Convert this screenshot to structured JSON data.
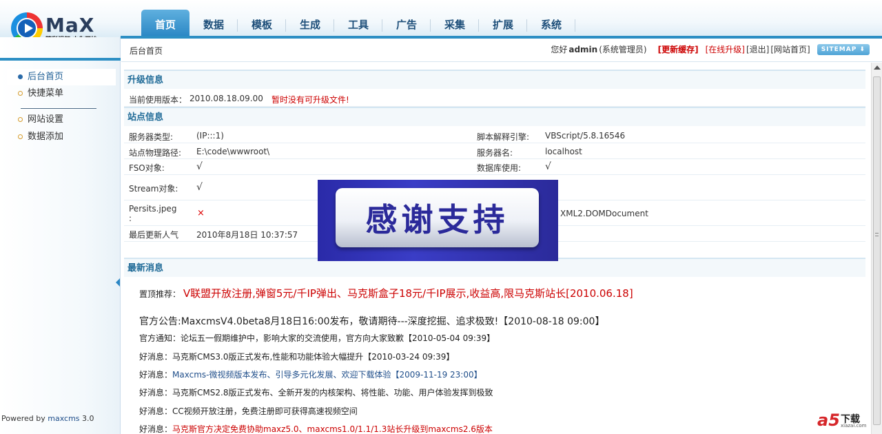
{
  "header": {
    "logo_word": "MaX",
    "logo_slogan": "精彩视频 由你开始",
    "nav": [
      "首页",
      "数据",
      "模板",
      "生成",
      "工具",
      "广告",
      "采集",
      "扩展",
      "系统"
    ]
  },
  "sidebar": {
    "items": [
      {
        "label": "后台首页",
        "active": true
      },
      {
        "label": "快捷菜单",
        "active": false
      },
      {
        "label": "网站设置",
        "active": false
      },
      {
        "label": "数据添加",
        "active": false
      }
    ],
    "powered_prefix": "Powered by",
    "powered_brand": "maxcms",
    "powered_version": "3.0"
  },
  "topbar": {
    "breadcrumb": "后台首页",
    "greeting": "您好",
    "username": "admin",
    "role": "(系统管理员)",
    "refresh_cache": "[更新缓存]",
    "online_upgrade": "[在线升级]",
    "logout": "[退出]",
    "site_home": "[网站首页]",
    "sitemap": "SITEMAP ⬇"
  },
  "upgrade": {
    "title": "升级信息",
    "version_label": "当前使用版本：",
    "version_value": "2010.08.18.09.00",
    "no_update": "暂时没有可升级文件!"
  },
  "site_info": {
    "title": "站点信息",
    "server_type_label": "服务器类型:",
    "server_type_value": "(IP:::1)",
    "script_engine_label": "脚本解释引擎:",
    "script_engine_value": "VBScript/5.8.16546",
    "physical_path_label": "站点物理路径:",
    "physical_path_value": "E:\\code\\wwwroot\\",
    "server_name_label": "服务器名:",
    "server_name_value": "localhost",
    "fso_label": "FSO对象:",
    "fso_value": "√",
    "db_label": "数据库使用:",
    "db_value": "√",
    "stream_label": "Stream对象:",
    "stream_value": "√",
    "persits_label_1": "Persits.jpeg",
    "persits_label_2": ":",
    "persits_value": "×",
    "xml_value": "XML2.DOMDocument",
    "last_update_label": "最后更新人气",
    "last_update_value": "2010年8月18日 10:37:57"
  },
  "news": {
    "title": "最新消息",
    "pinned_label": "置顶推荐：",
    "pinned_text": "V联盟开放注册,弹窗5元/千IP弹出、马克斯盒子18元/千IP展示,收益高,限马克斯站长[2010.06.18]",
    "official_announce": "官方公告:MaxcmsV4.0beta8月18日16:00发布，敬请期待---深度挖掘、追求极致!【2010-08-18 09:00】",
    "items": [
      {
        "prefix": "官方通知：",
        "text": "论坛五一假期维护中，影响大家的交流使用，官方向大家致歉【2010-05-04 09:39】",
        "color": "dark"
      },
      {
        "prefix": "好消息：",
        "text": "马克斯CMS3.0版正式发布,性能和功能体验大幅提升【2010-03-24 09:39】",
        "color": "dark"
      },
      {
        "prefix": "好消息：",
        "text": "Maxcms-微视频版本发布、引导多元化发展、欢迎下载体验【2009-11-19 23:00】",
        "color": "blue"
      },
      {
        "prefix": "好消息：",
        "text": "马克斯CMS2.8版正式发布、全新开发的内核架构、将性能、功能、用户体验发挥到极致",
        "color": "dark"
      },
      {
        "prefix": "好消息：",
        "text": "CC视频开放注册，免费注册即可获得高速视频空间",
        "color": "dark"
      },
      {
        "prefix": "好消息：",
        "text": "马克斯官方决定免费协助maxz5.0、maxcms1.0/1.1/1.3站长升级到maxcms2.6版本",
        "color": "red"
      }
    ]
  },
  "overlay": {
    "text": "感谢支持"
  },
  "watermark": {
    "mark": "a5",
    "text": "下载",
    "sub": "xiazai.com"
  }
}
